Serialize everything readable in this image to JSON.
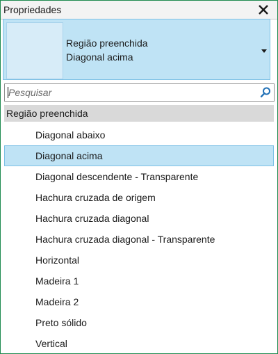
{
  "panel": {
    "title": "Propriedades"
  },
  "type_selector": {
    "family": "Região preenchida",
    "type": "Diagonal acima"
  },
  "search": {
    "placeholder": "Pesquisar",
    "value": ""
  },
  "group": {
    "label": "Região preenchida"
  },
  "items": [
    {
      "label": "Diagonal abaixo",
      "selected": false
    },
    {
      "label": "Diagonal acima",
      "selected": true
    },
    {
      "label": "Diagonal descendente - Transparente",
      "selected": false
    },
    {
      "label": "Hachura cruzada de origem",
      "selected": false
    },
    {
      "label": "Hachura cruzada diagonal",
      "selected": false
    },
    {
      "label": "Hachura cruzada diagonal  - Transparente",
      "selected": false
    },
    {
      "label": "Horizontal",
      "selected": false
    },
    {
      "label": "Madeira 1",
      "selected": false
    },
    {
      "label": "Madeira 2",
      "selected": false
    },
    {
      "label": "Preto sólido",
      "selected": false
    },
    {
      "label": "Vertical",
      "selected": false
    }
  ],
  "icons": {
    "close": "close-icon",
    "dropdown": "chevron-down-icon",
    "search": "search-icon"
  },
  "colors": {
    "border": "#1e8a4f",
    "selection_fill": "#bfe3f5",
    "selection_border": "#7cc0e5",
    "group_header": "#d9d9d9",
    "search_icon": "#1f6fb5"
  }
}
